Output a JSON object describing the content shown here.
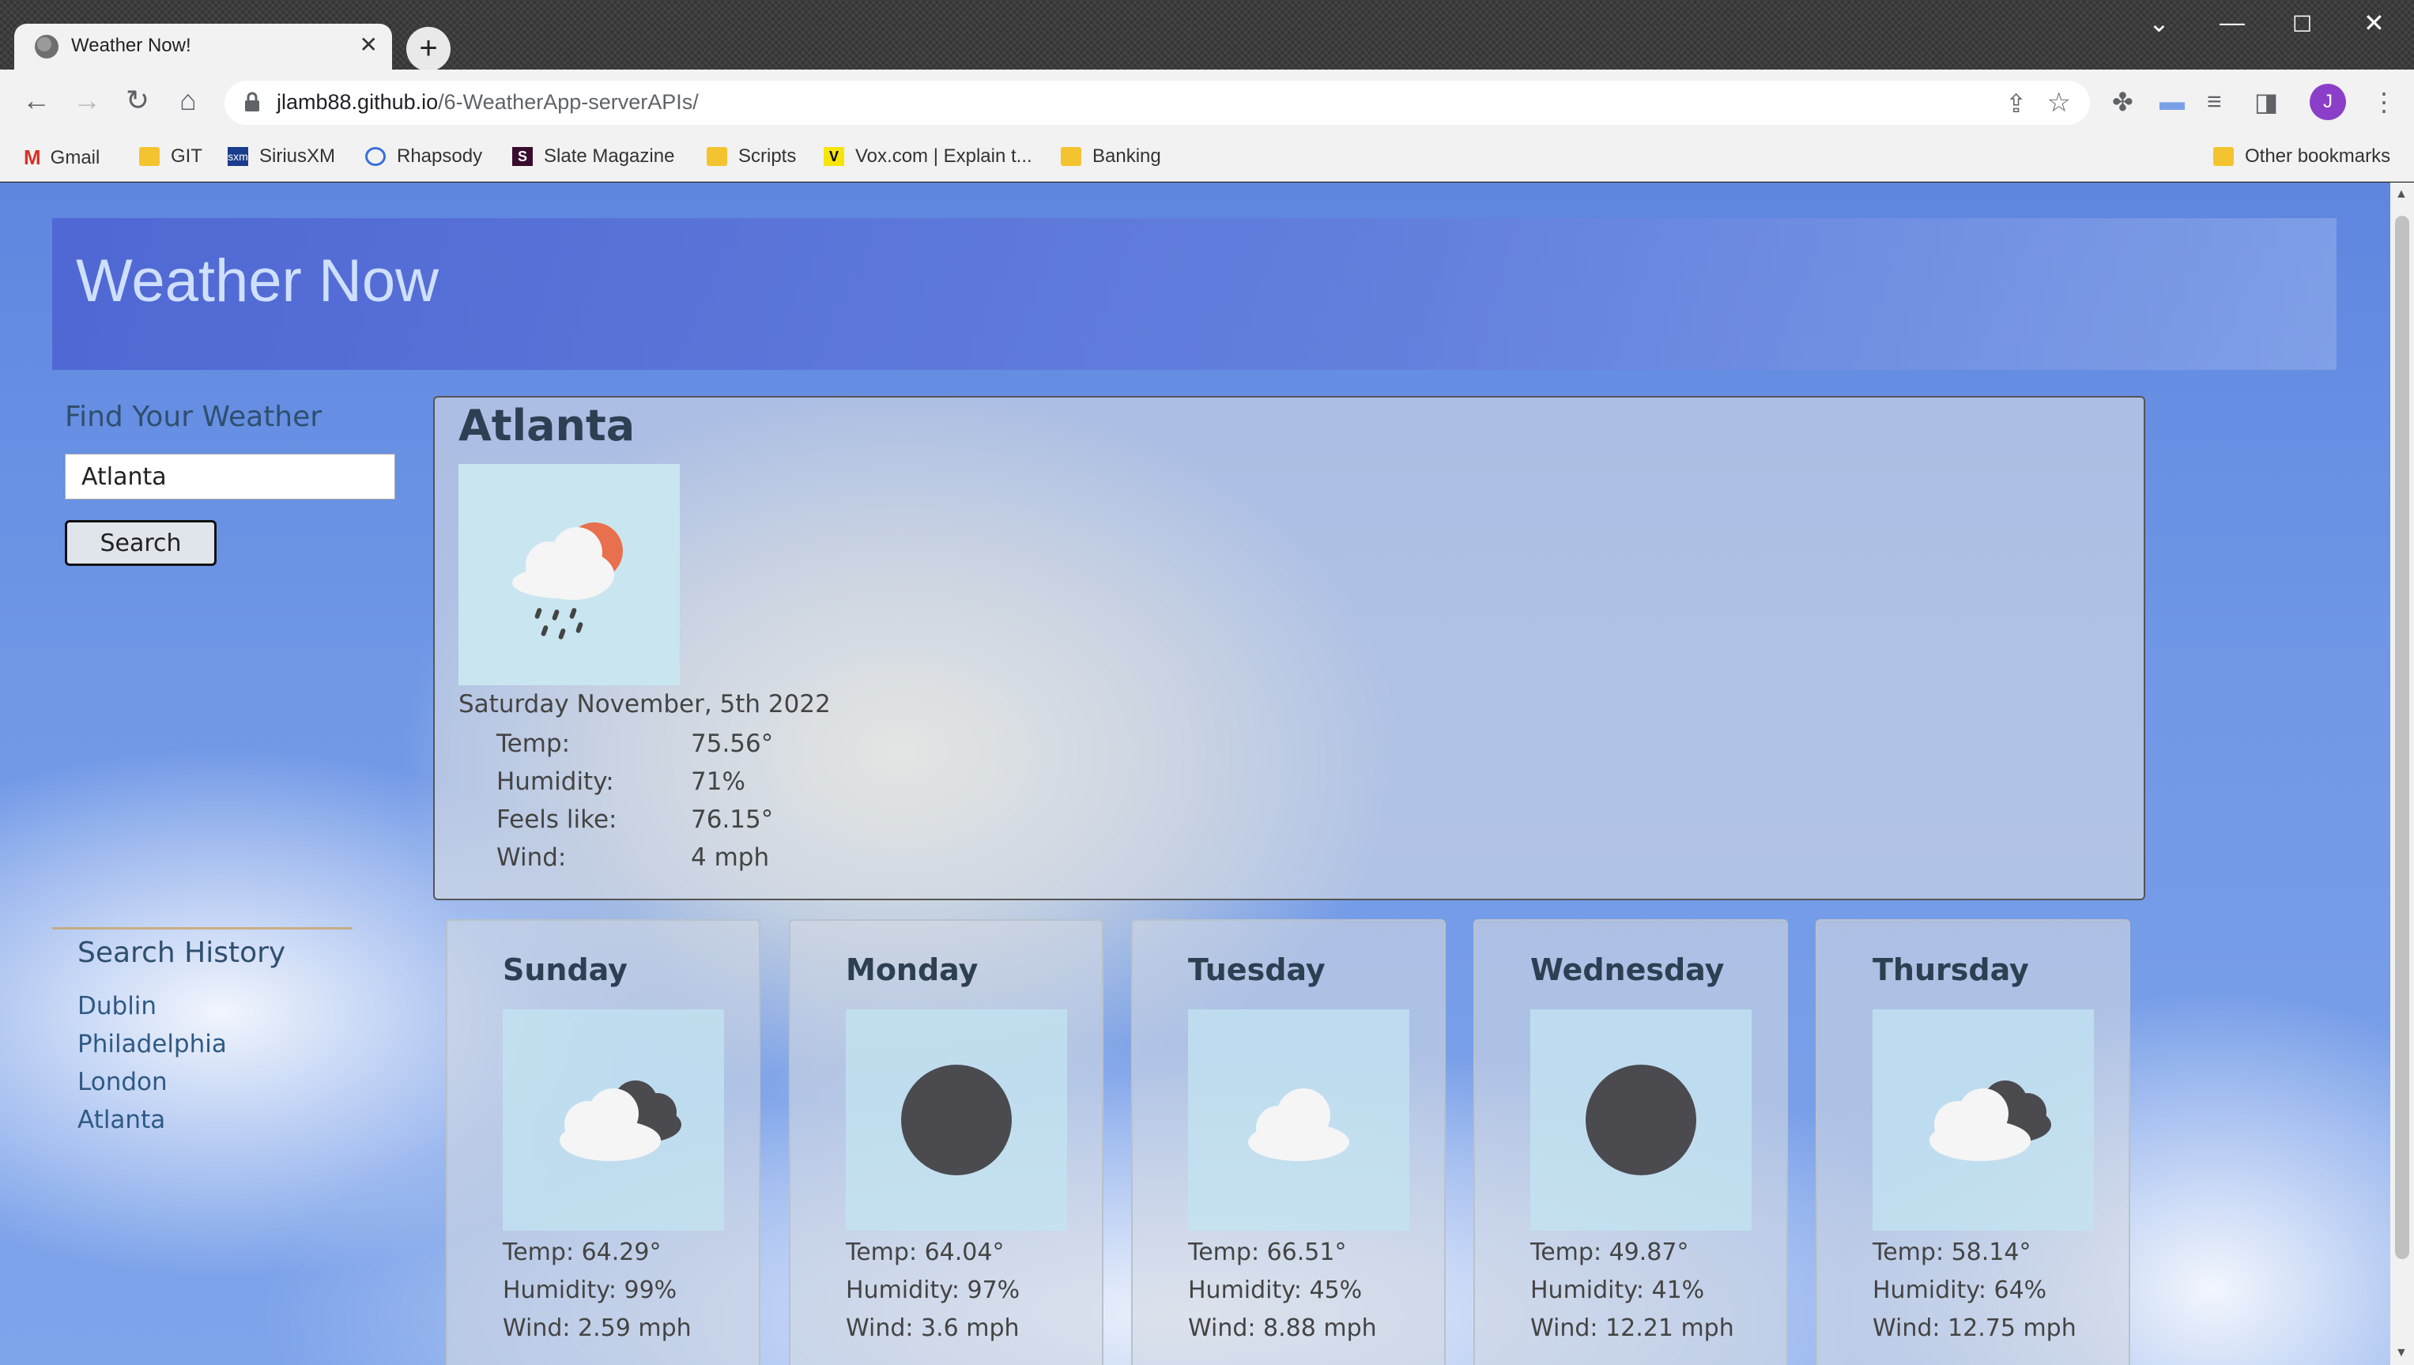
{
  "browser": {
    "tab_title": "Weather Now!",
    "url_host": "jlamb88.github.io",
    "url_path": "/6-WeatherApp-serverAPIs/",
    "profile_initial": "J",
    "bookmarks": [
      "Gmail",
      "GIT",
      "SiriusXM",
      "Rhapsody",
      "Slate Magazine",
      "Scripts",
      "Vox.com | Explain t...",
      "Banking"
    ],
    "other_bookmarks": "Other bookmarks"
  },
  "app": {
    "title": "Weather Now"
  },
  "search": {
    "heading": "Find Your Weather",
    "value": "Atlanta",
    "button_label": "Search"
  },
  "history": {
    "heading": "Search History",
    "items": [
      "Dublin",
      "Philadelphia",
      "London",
      "Atlanta"
    ]
  },
  "current": {
    "city": "Atlanta",
    "date": "Saturday November, 5th 2022",
    "icon": "cloud-rain-sun-icon",
    "rows": [
      {
        "label": "Temp:",
        "value": "75.56°"
      },
      {
        "label": "Humidity:",
        "value": "71%"
      },
      {
        "label": "Feels like:",
        "value": "76.15°"
      },
      {
        "label": "Wind:",
        "value": "4 mph"
      }
    ]
  },
  "forecast": [
    {
      "day": "Sunday",
      "icon": "cloudy-icon",
      "temp": "Temp: 64.29°",
      "humidity": "Humidity: 99%",
      "wind": "Wind: 2.59 mph"
    },
    {
      "day": "Monday",
      "icon": "clear-icon",
      "temp": "Temp: 64.04°",
      "humidity": "Humidity: 97%",
      "wind": "Wind: 3.6 mph"
    },
    {
      "day": "Tuesday",
      "icon": "cloud-icon",
      "temp": "Temp: 66.51°",
      "humidity": "Humidity: 45%",
      "wind": "Wind: 8.88 mph"
    },
    {
      "day": "Wednesday",
      "icon": "clear-icon",
      "temp": "Temp: 49.87°",
      "humidity": "Humidity: 41%",
      "wind": "Wind: 12.21 mph"
    },
    {
      "day": "Thursday",
      "icon": "cloudy-icon",
      "temp": "Temp: 58.14°",
      "humidity": "Humidity: 64%",
      "wind": "Wind: 12.75 mph"
    }
  ]
}
